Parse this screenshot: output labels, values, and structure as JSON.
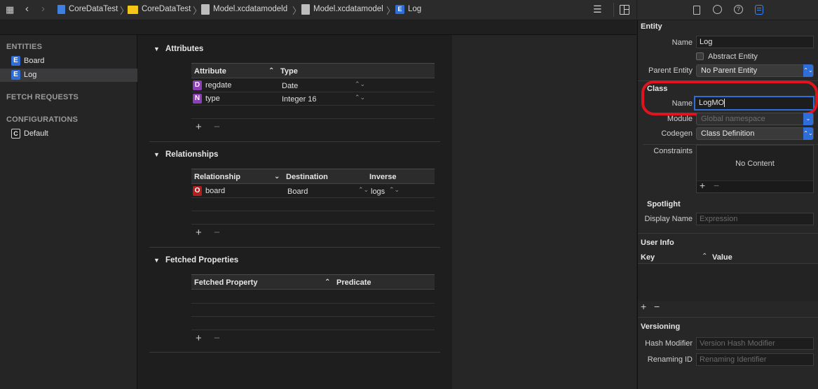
{
  "breadcrumb": {
    "items": [
      {
        "label": "CoreDataTest",
        "icon": "project-file-icon"
      },
      {
        "label": "CoreDataTest",
        "icon": "folder-icon"
      },
      {
        "label": "Model.xcdatamodeld",
        "icon": "datamodel-bundle-icon"
      },
      {
        "label": "Model.xcdatamodel",
        "icon": "datamodel-icon"
      },
      {
        "label": "Log",
        "icon": "entity-icon"
      }
    ]
  },
  "sidebar": {
    "entities_header": "ENTITIES",
    "entities": [
      {
        "badge": "E",
        "label": "Board"
      },
      {
        "badge": "E",
        "label": "Log"
      }
    ],
    "fetch_requests_header": "FETCH REQUESTS",
    "configurations_header": "CONFIGURATIONS",
    "configurations": [
      {
        "badge": "C",
        "label": "Default"
      }
    ]
  },
  "editor": {
    "attributes": {
      "title": "Attributes",
      "col_attribute": "Attribute",
      "col_type": "Type",
      "rows": [
        {
          "badge": "D",
          "name": "regdate",
          "type": "Date",
          "badge_color": "#8e3fb8"
        },
        {
          "badge": "N",
          "name": "type",
          "type": "Integer 16",
          "badge_color": "#8e3fb8"
        }
      ]
    },
    "relationships": {
      "title": "Relationships",
      "col_relationship": "Relationship",
      "col_destination": "Destination",
      "col_inverse": "Inverse",
      "rows": [
        {
          "badge": "O",
          "name": "board",
          "destination": "Board",
          "inverse": "logs",
          "badge_color": "#b31f1f"
        }
      ]
    },
    "fetched_properties": {
      "title": "Fetched Properties",
      "col_fetched_property": "Fetched Property",
      "col_predicate": "Predicate"
    },
    "add_symbol": "+",
    "remove_symbol": "−"
  },
  "inspector": {
    "entity_header": "Entity",
    "name_label": "Name",
    "name_value": "Log",
    "abstract_label": "Abstract Entity",
    "parent_label": "Parent Entity",
    "parent_value": "No Parent Entity",
    "class_header": "Class",
    "class_name_label": "Name",
    "class_name_value": "LogMO",
    "module_label": "Module",
    "module_placeholder": "Global namespace",
    "codegen_label": "Codegen",
    "codegen_value": "Class Definition",
    "constraints_label": "Constraints",
    "constraints_empty": "No Content",
    "spotlight_header": "Spotlight",
    "display_name_label": "Display Name",
    "display_name_placeholder": "Expression",
    "user_info_header": "User Info",
    "col_key": "Key",
    "col_value": "Value",
    "versioning_header": "Versioning",
    "hash_modifier_label": "Hash Modifier",
    "hash_modifier_placeholder": "Version Hash Modifier",
    "renaming_id_label": "Renaming ID",
    "renaming_id_placeholder": "Renaming Identifier"
  },
  "colors": {
    "accent": "#2f6ed8",
    "highlight": "#e0141e"
  }
}
